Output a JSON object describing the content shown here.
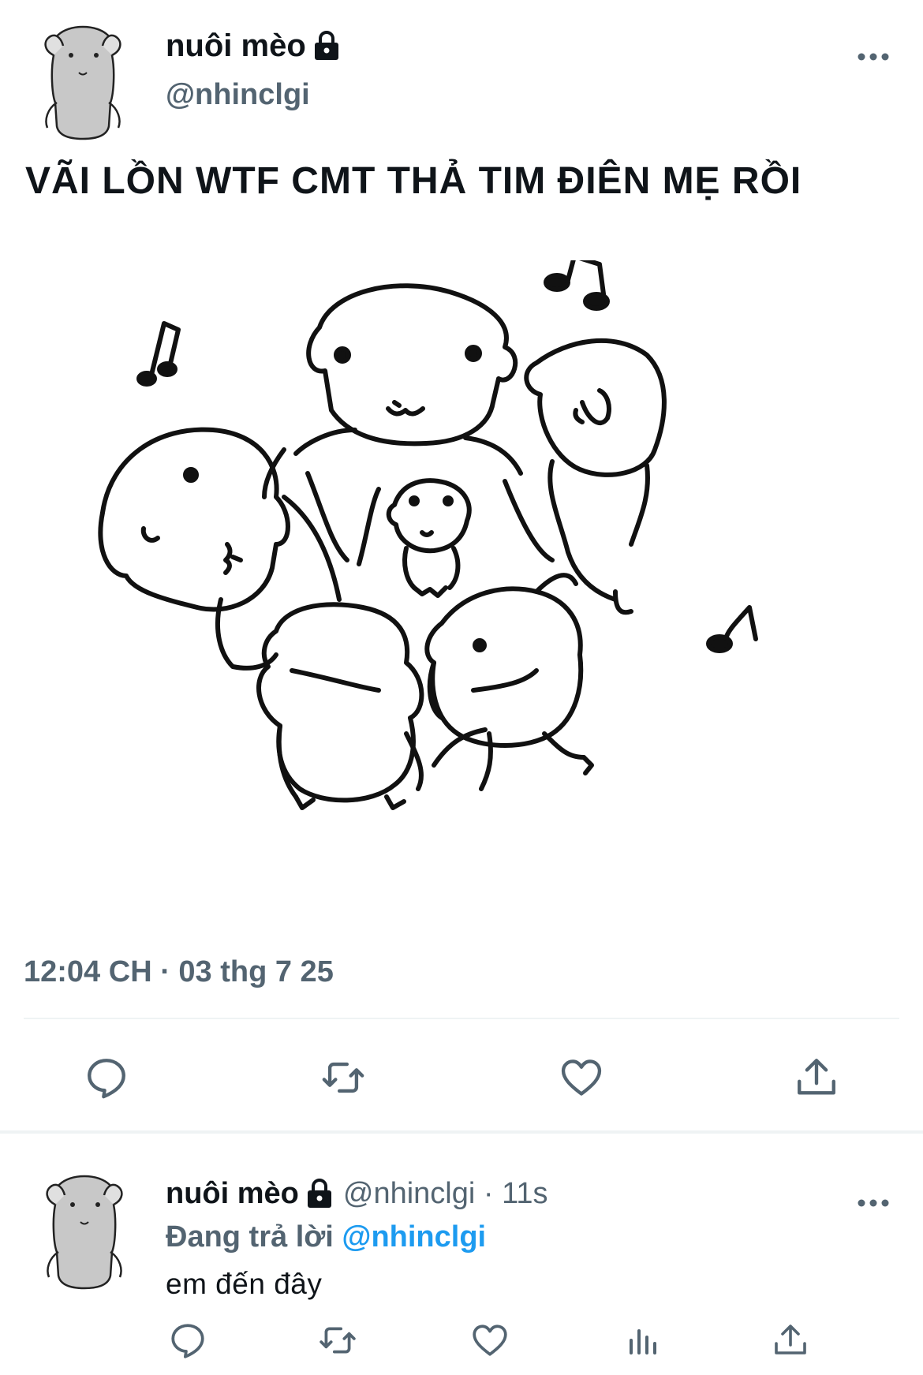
{
  "tweet": {
    "display_name": "nuôi mèo",
    "handle": "@nhinclgi",
    "text": "VÃI LỒN WTF CMT THẢ TIM ĐIÊN MẸ RỒI",
    "timestamp": "12:04 CH · 03 thg 7 25",
    "image_alt_icon": "dancing-puppies-illustration"
  },
  "actions": {
    "reply_icon": "reply-icon",
    "retweet_icon": "retweet-icon",
    "like_icon": "heart-icon",
    "share_icon": "share-icon"
  },
  "reply": {
    "display_name": "nuôi mèo",
    "meta": "@nhinclgi · 11s",
    "replying_prefix": "Đang trả lời",
    "replying_handle": "@nhinclgi",
    "text": "em đến đây"
  },
  "colors": {
    "text": "#0f1419",
    "secondary": "#536471",
    "link": "#1d9bf0",
    "divider": "#eff3f4"
  }
}
